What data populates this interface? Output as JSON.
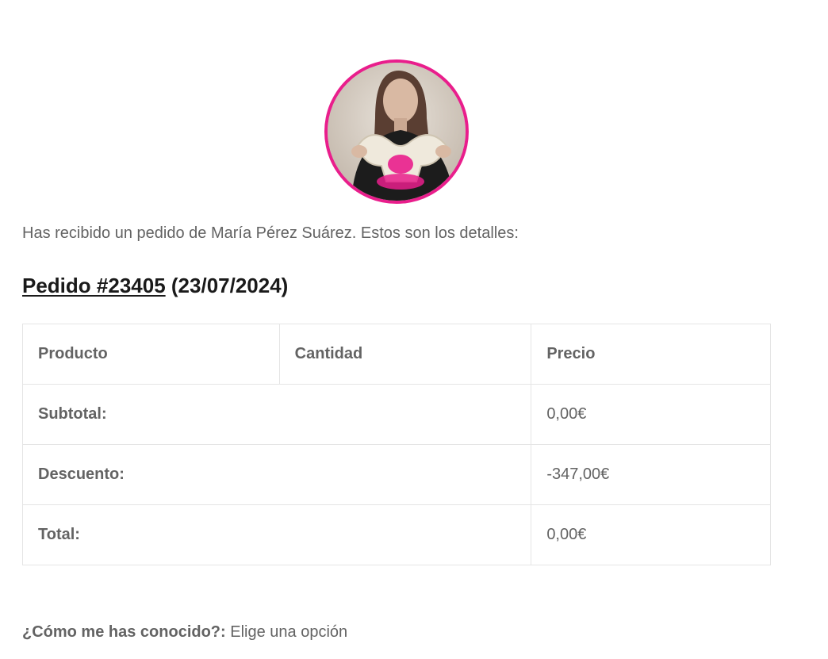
{
  "header": {
    "avatar_alt": "María avatar"
  },
  "intro": {
    "text": "Has recibido un pedido de María Pérez Suárez. Estos son los detalles:"
  },
  "order": {
    "link_text": "Pedido #23405",
    "date_text": "(23/07/2024)"
  },
  "table": {
    "headers": [
      "Producto",
      "Cantidad",
      "Precio"
    ],
    "totals": [
      {
        "label": "Subtotal:",
        "value": "0,00€"
      },
      {
        "label": "Descuento:",
        "value": "-347,00€"
      },
      {
        "label": "Total:",
        "value": "0,00€"
      }
    ]
  },
  "question": {
    "label": "¿Cómo me has conocido?:",
    "value": "Elige una opción"
  },
  "colors": {
    "accent": "#e91e8c",
    "text": "#636363",
    "heading": "#1a1a1a",
    "border": "#e5e5e5"
  }
}
